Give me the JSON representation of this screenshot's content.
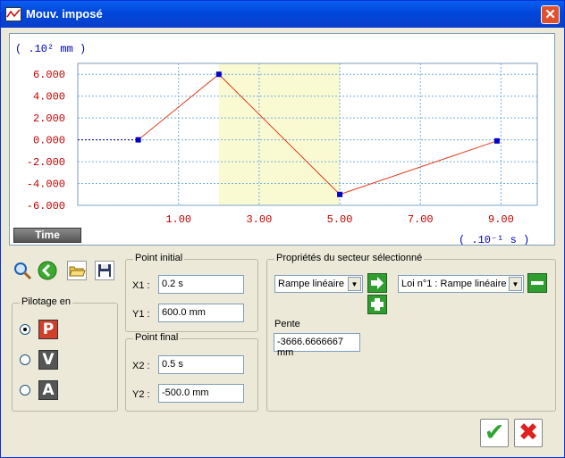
{
  "window": {
    "title": "Mouv. imposé",
    "close_glyph": "✕"
  },
  "chart_data": {
    "type": "line",
    "y_unit_label": "( .10² mm )",
    "x_unit_label": "( .10⁻¹ s )",
    "y_ticks": [
      "6.000",
      "4.000",
      "2.000",
      "0.000",
      "-2.000",
      "-4.000",
      "-6.000"
    ],
    "x_ticks": [
      "1.00",
      "3.00",
      "5.00",
      "7.00",
      "9.00"
    ],
    "ylim": [
      -6,
      7
    ],
    "xlim": [
      -1.5,
      9.9
    ],
    "points": [
      {
        "x": 0,
        "y": 0
      },
      {
        "x": 2,
        "y": 6
      },
      {
        "x": 5,
        "y": -5
      },
      {
        "x": 8.9,
        "y": -0.1
      }
    ],
    "pre_segment": {
      "x0": -1.5,
      "x1": 0,
      "y": 0
    },
    "highlight_range": [
      2,
      5
    ],
    "grid": true,
    "colors": {
      "line": "#E04020",
      "point": "#0000C8",
      "highlight": "#FAFAD2",
      "axis_text": "#C00000",
      "unit_text": "#0000C0",
      "grid": "#70B0E0"
    }
  },
  "time_button": {
    "label": "Time"
  },
  "toolbar": {
    "icons": [
      "magnifier-icon",
      "back-arrow-icon",
      "open-folder-icon",
      "save-disk-icon"
    ]
  },
  "pilotage": {
    "title": "Pilotage en",
    "modes": [
      {
        "letter": "P",
        "selected": true,
        "color": "#D0402A"
      },
      {
        "letter": "V",
        "selected": false,
        "color": "#555555"
      },
      {
        "letter": "A",
        "selected": false,
        "color": "#555555"
      }
    ]
  },
  "point_initial": {
    "title": "Point initial",
    "x_label": "X1 :",
    "x_value": "0.2 s",
    "y_label": "Y1 :",
    "y_value": "600.0 mm"
  },
  "point_final": {
    "title": "Point final",
    "x_label": "X2 :",
    "x_value": "0.5 s",
    "y_label": "Y2 :",
    "y_value": "-500.0 mm"
  },
  "sector": {
    "title": "Propriétés du secteur sélectionné",
    "type_select": "Rampe linéaire",
    "law_select": "Loi n°1 : Rampe linéaire",
    "slope_label": "Pente",
    "slope_value": "-3666.6666667 mm"
  },
  "actions": {
    "ok_glyph": "✔",
    "cancel_glyph": "✖"
  }
}
